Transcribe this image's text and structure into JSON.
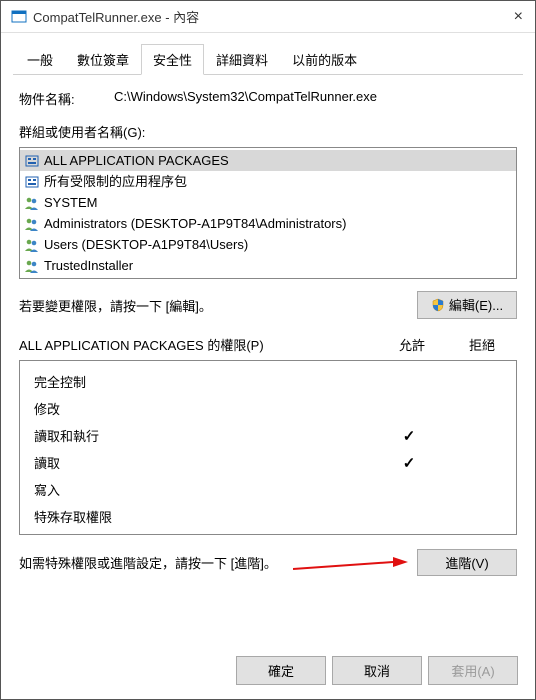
{
  "titlebar": {
    "title": "CompatTelRunner.exe - 內容"
  },
  "tabs": {
    "general": "一般",
    "digital": "數位簽章",
    "security": "安全性",
    "details": "詳細資料",
    "previous": "以前的版本"
  },
  "object": {
    "label": "物件名稱:",
    "value": "C:\\Windows\\System32\\CompatTelRunner.exe"
  },
  "groups": {
    "label": "群組或使用者名稱(G):",
    "items": [
      {
        "name": "ALL APPLICATION PACKAGES",
        "type": "package",
        "selected": true
      },
      {
        "name": "所有受限制的应用程序包",
        "type": "package",
        "selected": false
      },
      {
        "name": "SYSTEM",
        "type": "users",
        "selected": false
      },
      {
        "name": "Administrators (DESKTOP-A1P9T84\\Administrators)",
        "type": "users",
        "selected": false
      },
      {
        "name": "Users (DESKTOP-A1P9T84\\Users)",
        "type": "users",
        "selected": false
      },
      {
        "name": "TrustedInstaller",
        "type": "users",
        "selected": false
      }
    ]
  },
  "edit": {
    "hint": "若要變更權限，請按一下 [編輯]。",
    "button": "編輯(E)..."
  },
  "perm": {
    "header": "ALL APPLICATION PACKAGES 的權限(P)",
    "allow": "允許",
    "deny": "拒絕",
    "rows": [
      {
        "label": "完全控制",
        "allow": false,
        "deny": false
      },
      {
        "label": "修改",
        "allow": false,
        "deny": false
      },
      {
        "label": "讀取和執行",
        "allow": true,
        "deny": false
      },
      {
        "label": "讀取",
        "allow": true,
        "deny": false
      },
      {
        "label": "寫入",
        "allow": false,
        "deny": false
      },
      {
        "label": "特殊存取權限",
        "allow": false,
        "deny": false
      }
    ]
  },
  "advanced": {
    "hint": "如需特殊權限或進階設定，請按一下 [進階]。",
    "button": "進階(V)"
  },
  "footer": {
    "ok": "確定",
    "cancel": "取消",
    "apply": "套用(A)"
  }
}
